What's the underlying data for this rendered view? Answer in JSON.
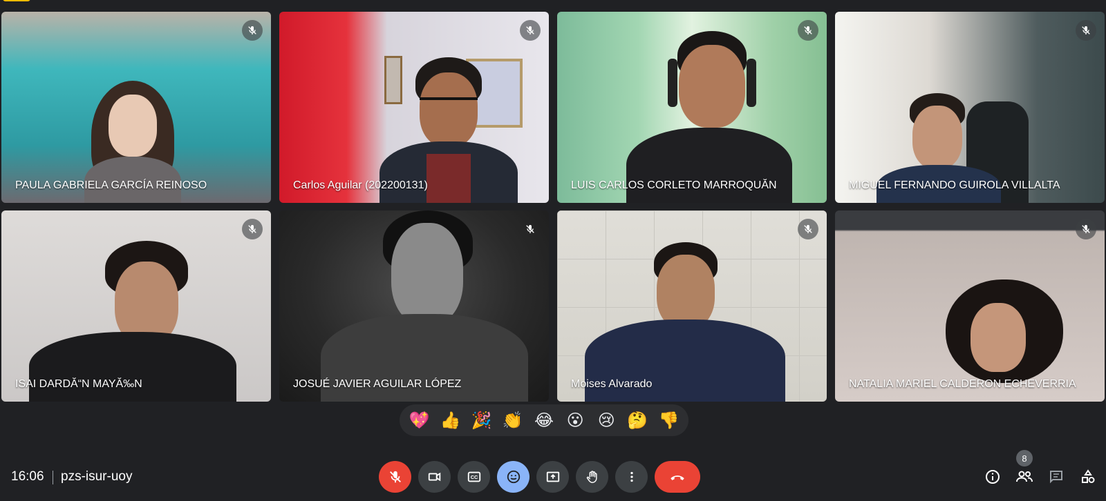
{
  "participants": [
    {
      "name": "PAULA GABRIELA GARCÍA REINOSO",
      "muted": true
    },
    {
      "name": "Carlos Aguilar (202200131)",
      "muted": true
    },
    {
      "name": "LUIS CARLOS CORLETO MARROQUĂN",
      "muted": true
    },
    {
      "name": "MIGUEL FERNANDO GUIROLA VILLALTA",
      "muted": true
    },
    {
      "name": "ISAI DARDĂ“N MAYĂ‰N",
      "muted": true
    },
    {
      "name": "JOSUÉ JAVIER AGUILAR LÓPEZ",
      "muted": true
    },
    {
      "name": "Moises Alvarado",
      "muted": true
    },
    {
      "name": "NATALIA MARIEL CALDERON ECHEVERRIA",
      "muted": true
    }
  ],
  "reactions": [
    "💖",
    "👍",
    "🎉",
    "👏",
    "😂",
    "😮",
    "😢",
    "🤔",
    "👎"
  ],
  "footer": {
    "time": "16:06",
    "meeting_code": "pzs-isur-uoy",
    "participant_count": "8"
  },
  "colors": {
    "background": "#202124",
    "mic_off": "#ea4335",
    "reactions_active": "#8ab4f8",
    "end_call": "#ea4335"
  }
}
